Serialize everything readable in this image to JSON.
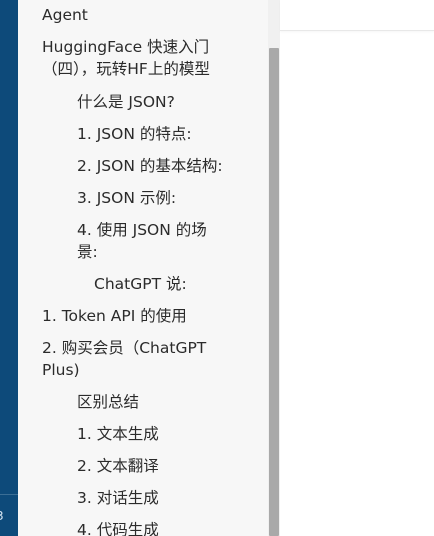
{
  "left_rail": {
    "number": "3"
  },
  "toc": {
    "items": [
      {
        "label": "Agent",
        "level": 0
      },
      {
        "label": "HuggingFace 快速入门（四），玩转HF上的模型",
        "level": 0
      },
      {
        "label": "什么是 JSON?",
        "level": 1
      },
      {
        "label": "1. JSON 的特点:",
        "level": 1
      },
      {
        "label": "2. JSON 的基本结构:",
        "level": 1
      },
      {
        "label": "3. JSON 示例:",
        "level": 1
      },
      {
        "label": "4. 使用 JSON 的场景:",
        "level": 1
      },
      {
        "label": "ChatGPT 说:",
        "level": 2
      },
      {
        "label": "1. Token API 的使用",
        "level": 0
      },
      {
        "label": "2. 购买会员（ChatGPT Plus)",
        "level": 0
      },
      {
        "label": "区别总结",
        "level": 1
      },
      {
        "label": "1. 文本生成",
        "level": 1
      },
      {
        "label": "2. 文本翻译",
        "level": 1
      },
      {
        "label": "3. 对话生成",
        "level": 1
      },
      {
        "label": "4. 代码生成",
        "level": 1
      }
    ]
  }
}
